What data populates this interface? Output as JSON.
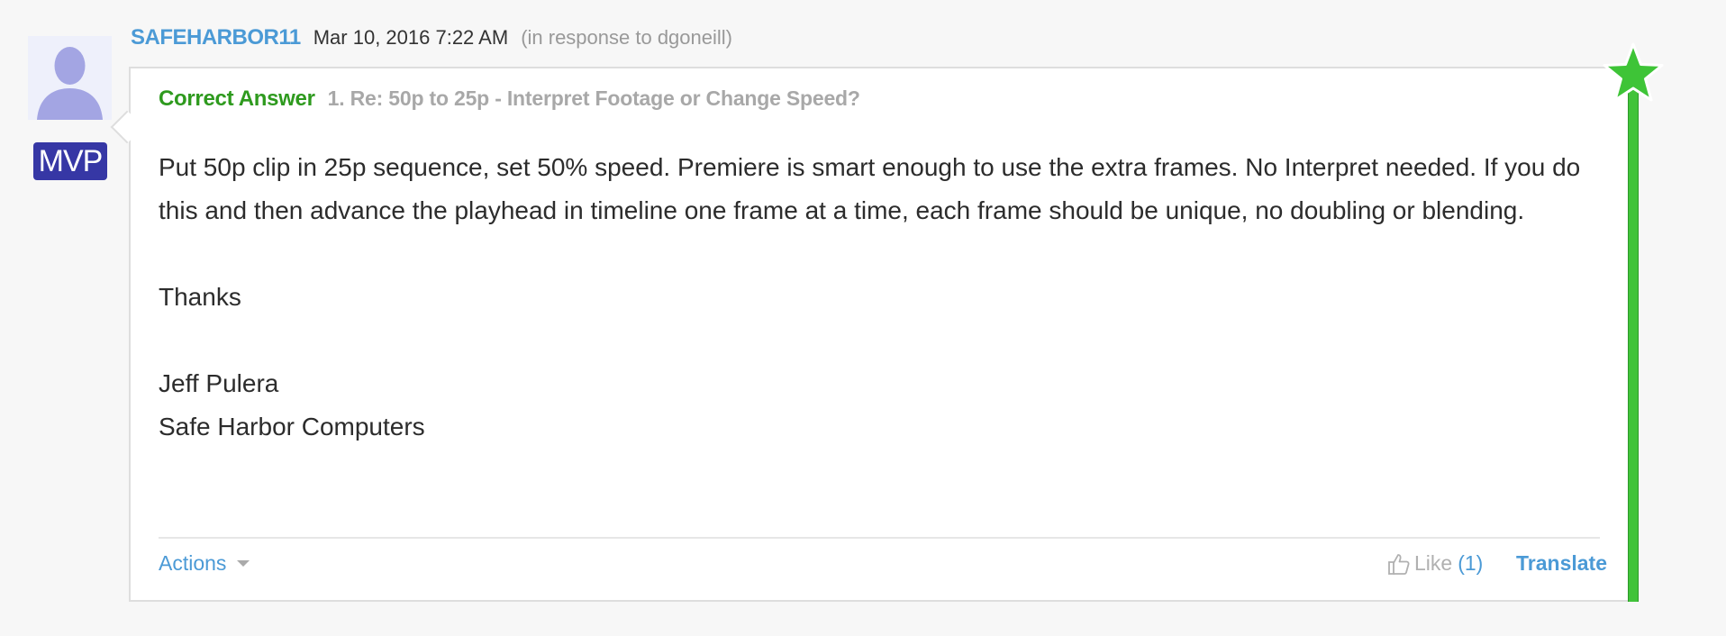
{
  "post": {
    "author": "SAFEHARBOR11",
    "date": "Mar 10, 2016 7:22 AM",
    "in_response_to": "(in response to dgoneill)",
    "badge": "MVP",
    "correct_answer_label": "Correct Answer",
    "thread_title": "1. Re: 50p to 25p - Interpret Footage or Change Speed?",
    "body": {
      "paragraph": "Put 50p clip in 25p sequence, set 50% speed. Premiere is smart enough to use the extra frames. No Interpret needed. If you do this and then advance the playhead in timeline one frame at a time, each frame should be unique, no doubling or blending.",
      "thanks": "Thanks",
      "signature_name": "Jeff Pulera",
      "signature_company": "Safe Harbor Computers"
    },
    "footer": {
      "actions_label": "Actions",
      "like_label": "Like",
      "like_count": "(1)",
      "translate_label": "Translate"
    }
  },
  "icons": {
    "avatar": "user-silhouette-icon",
    "star": "star-icon",
    "caret": "chevron-down-icon",
    "like": "thumbs-up-icon"
  },
  "colors": {
    "link": "#4b9ad6",
    "correct": "#2e9a1e",
    "answer_bar": "#41c33a",
    "badge": "#3637a5"
  }
}
